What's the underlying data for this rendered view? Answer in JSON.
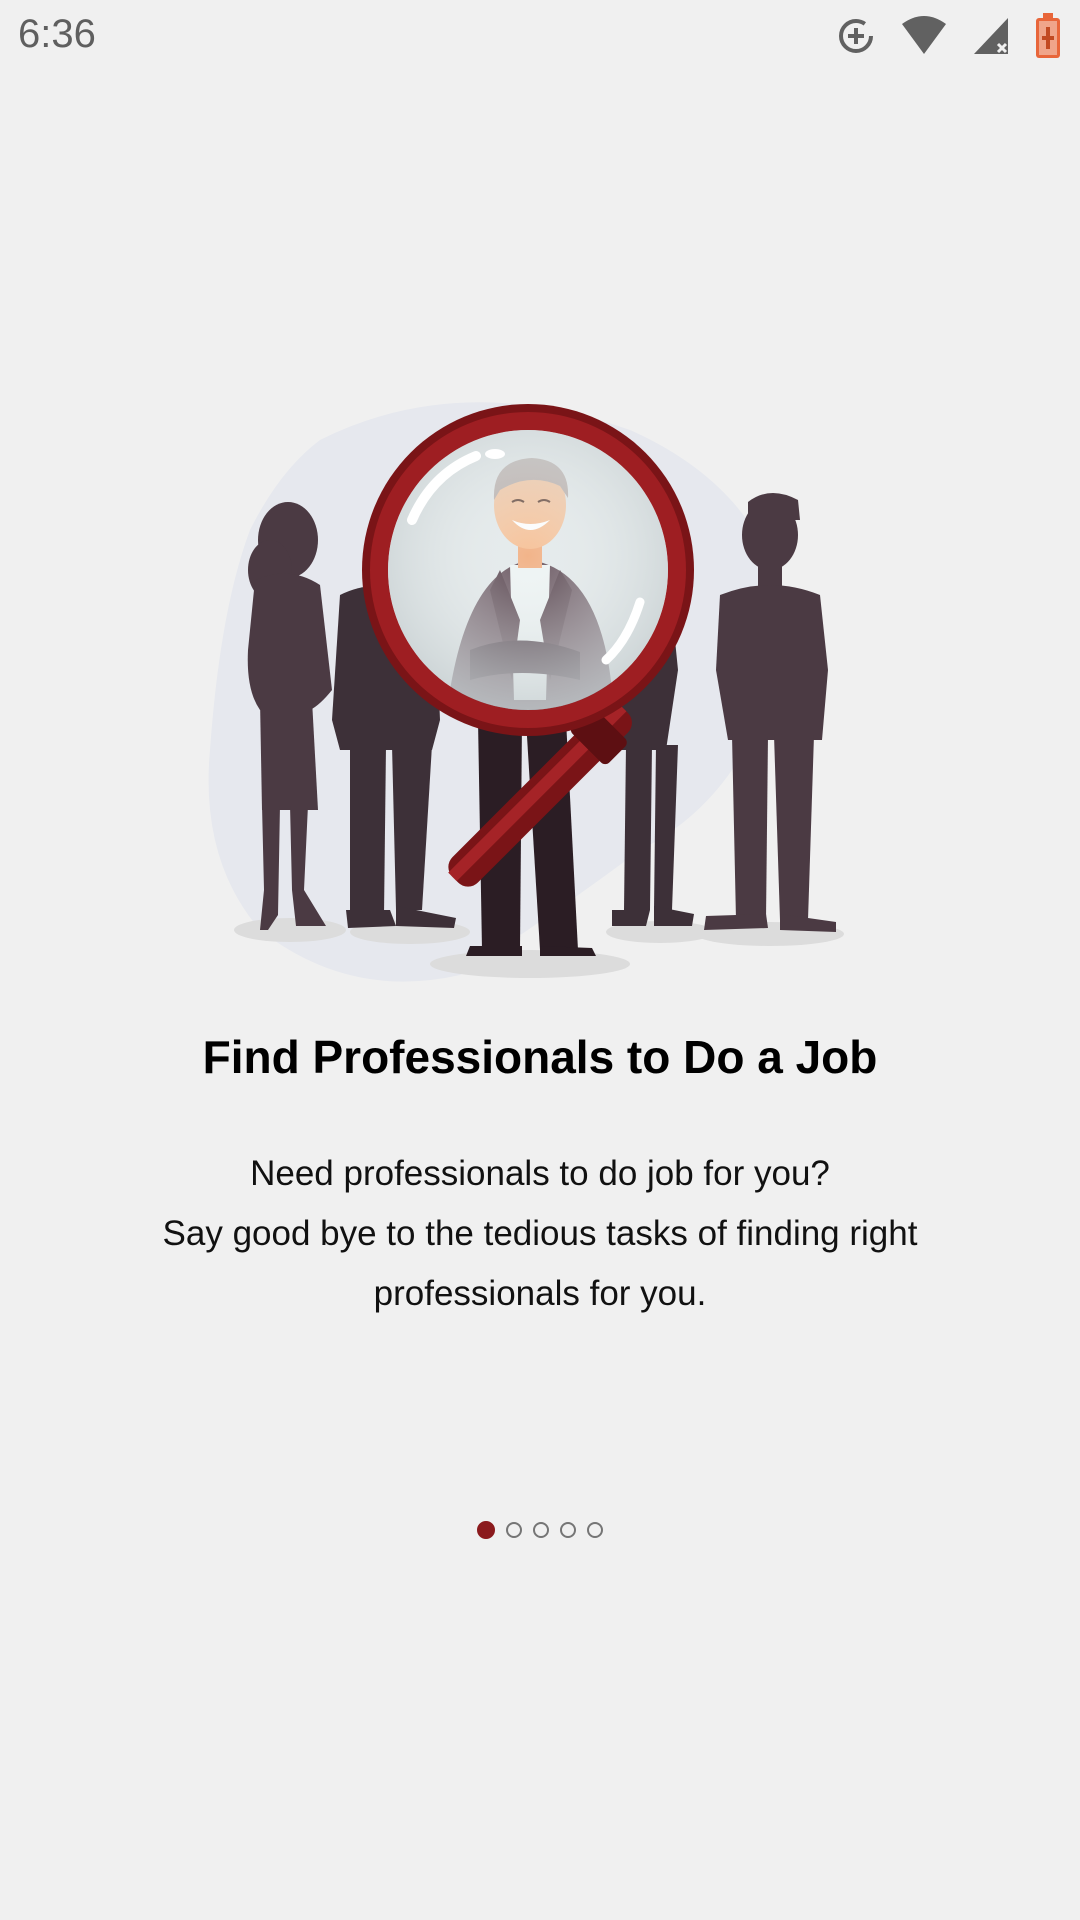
{
  "status_bar": {
    "time": "6:36",
    "icons": [
      "data-saver-icon",
      "wifi-icon",
      "cell-signal-icon",
      "battery-charging-icon"
    ]
  },
  "onboarding": {
    "illustration": "magnifier-professionals-illustration",
    "title": "Find Professionals to Do a Job",
    "description_lines": [
      "Need professionals to do job for you?",
      "Say good bye to the tedious tasks of finding right",
      "professionals for you."
    ]
  },
  "pager": {
    "total": 5,
    "current": 1
  },
  "colors": {
    "accent": "#8b1a1d",
    "silhouette": "#4a3b43",
    "background": "#f0f0f0",
    "blob": "#e6e8ee"
  }
}
